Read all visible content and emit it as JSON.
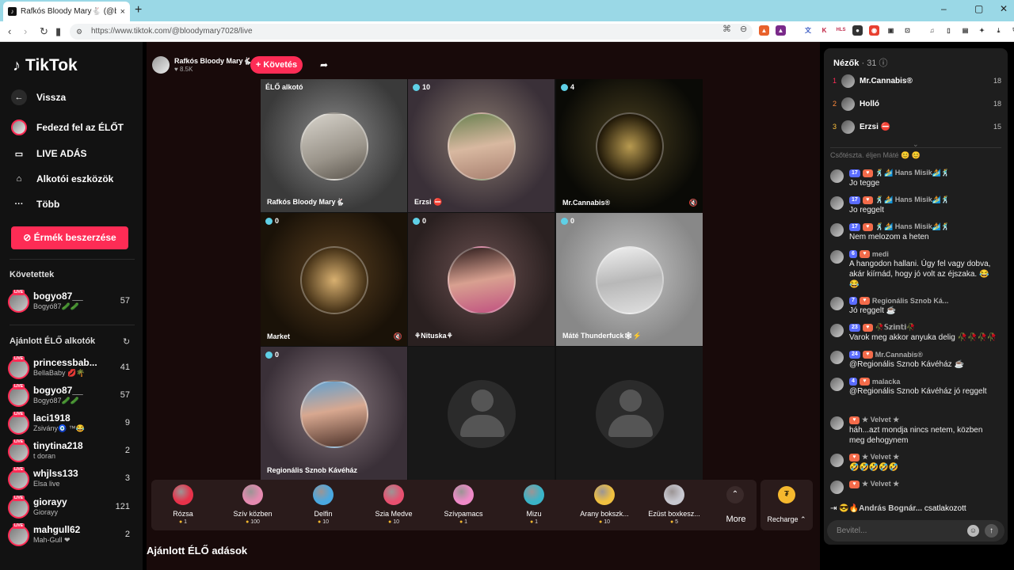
{
  "browser": {
    "tab_title": "Rafkós Bloody Mary🐇 (@bl",
    "tab_close": "×",
    "new_tab": "+",
    "url": "https://www.tiktok.com/@bloodymary7028/live",
    "win_min": "–",
    "win_max": "▢",
    "win_close": "✕"
  },
  "sidebar": {
    "logo": "TikTok",
    "back": "Vissza",
    "nav": [
      {
        "label": "Fedezd fel az ÉLŐT",
        "icon": "avatar"
      },
      {
        "label": "LIVE ADÁS",
        "icon": "camera-icon"
      },
      {
        "label": "Alkotói eszközök",
        "icon": "tools-icon"
      },
      {
        "label": "Több",
        "icon": "more-icon"
      }
    ],
    "coins_button": "Érmék beszerzése",
    "following_title": "Követettek",
    "following": [
      {
        "name": "bogyo87__",
        "sub": "Bogyó87🥒🥒",
        "count": "57"
      }
    ],
    "recommended_title": "Ajánlott ÉLŐ alkotók",
    "recommended": [
      {
        "name": "princessbab...",
        "sub": "BellaBaby 💋🌴",
        "count": "41"
      },
      {
        "name": "bogyo87__",
        "sub": "Bogyó87🥒🥒",
        "count": "57"
      },
      {
        "name": "laci1918",
        "sub": "Zsivány🧿 ™😂",
        "count": "9"
      },
      {
        "name": "tinytina218",
        "sub": "t doran",
        "count": "2"
      },
      {
        "name": "whjlss133",
        "sub": "Elsa live",
        "count": "3"
      },
      {
        "name": "giorayy",
        "sub": "Giorayy",
        "count": "121"
      },
      {
        "name": "mahgull62",
        "sub": "Mah-Gull ❤",
        "count": "2"
      }
    ],
    "live_badge": "LIVE"
  },
  "stream": {
    "host_name": "Rafkós Bloody Mary🐇",
    "likes": "♥ 8.5K",
    "follow_button": "+ Követés",
    "share_icon": "➦",
    "cells": [
      {
        "badge": "ÉLŐ alkotó",
        "label": "Rafkós Bloody Mary🐇",
        "count": ""
      },
      {
        "badge": "10",
        "label": "Erzsi ⛔",
        "count": "10"
      },
      {
        "badge": "4",
        "label": "Mr.Cannabis®",
        "count": "4"
      },
      {
        "badge": "0",
        "label": "Market",
        "count": "0"
      },
      {
        "badge": "0",
        "label": "⚘Nituska⚘",
        "count": "0"
      },
      {
        "badge": "0",
        "label": "Máté Thunderfuck🕸⚡",
        "count": "0"
      },
      {
        "badge": "0",
        "label": "Regionális Sznob Kávéház",
        "count": "0"
      }
    ],
    "mute_icon": "🔇"
  },
  "gifts": [
    {
      "name": "Rózsa",
      "price": "1",
      "color": "#e8324a"
    },
    {
      "name": "Szív közben",
      "price": "100",
      "color": "#e58ab0"
    },
    {
      "name": "Delfin",
      "price": "10",
      "color": "#4aa8e0"
    },
    {
      "name": "Szia Medve",
      "price": "10",
      "color": "#e85070"
    },
    {
      "name": "Szívpamacs",
      "price": "1",
      "color": "#f08ac8"
    },
    {
      "name": "Mizu",
      "price": "1",
      "color": "#3ab4c8"
    },
    {
      "name": "Arany bokszk...",
      "price": "10",
      "color": "#f0c040"
    },
    {
      "name": "Ezüst boxkesz...",
      "price": "5",
      "color": "#c8c8d0"
    }
  ],
  "gift_more": "More",
  "gift_more_icon": "⌃",
  "recharge": "Recharge ⌃",
  "recommended_streams_title": "Ajánlott ÉLŐ adások",
  "chat": {
    "viewers_title": "Nézők",
    "viewers_count": "· 31",
    "viewers": [
      {
        "rank": "1",
        "name": "Mr.Cannabis®",
        "score": "18"
      },
      {
        "rank": "2",
        "name": "Holló",
        "score": "18"
      },
      {
        "rank": "3",
        "name": "Erzsi ⛔",
        "score": "15"
      }
    ],
    "faded": "Csőtészta. éljen Máté 😊 😊",
    "messages": [
      {
        "level": "17",
        "user": "🕺🏄 Hans Misik🏄🕺",
        "text": "Jo tegge"
      },
      {
        "level": "17",
        "user": "🕺🏄 Hans Misik🏄🕺",
        "text": "Jo reggelt"
      },
      {
        "level": "17",
        "user": "🕺🏄 Hans Misik🏄🕺",
        "text": "Nem melozom a heten"
      },
      {
        "level": "6",
        "user": "medi",
        "text": "A hangodon hallani. Úgy fel vagy dobva, akár kiírnád, hogy jó volt az éjszaka. 😂 😂"
      },
      {
        "level": "7",
        "user": "Regionális Sznob Ká...",
        "text": "Jó reggelt ☕"
      },
      {
        "level": "23",
        "user": "🥀𝕊𝕫𝕚𝕟𝕥𝕚🥀",
        "text": "Varok meg akkor anyuka delig 🥀🥀🥀🥀"
      },
      {
        "level": "24",
        "user": "Mr.Cannabis®",
        "text": "@Regionális Sznob Kávéház ☕"
      },
      {
        "level": "4",
        "user": "malacka",
        "text": "@Regionális Sznob Kávéház jó reggelt"
      },
      {
        "level": "",
        "user": "★ Velvet ★",
        "text": "háh...azt mondja nincs netem, közben meg dehogynem"
      },
      {
        "level": "",
        "user": "★ Velvet ★",
        "text": "🤣🤣🤣🤣🤣"
      },
      {
        "level": "",
        "user": "★ Velvet ★",
        "text": ""
      }
    ],
    "joined_user": "😎🔥András Bognár...",
    "joined_text": "csatlakozott",
    "input_placeholder": "Bevitel...",
    "send_icon": "↑",
    "emoji_icon": "☺"
  }
}
